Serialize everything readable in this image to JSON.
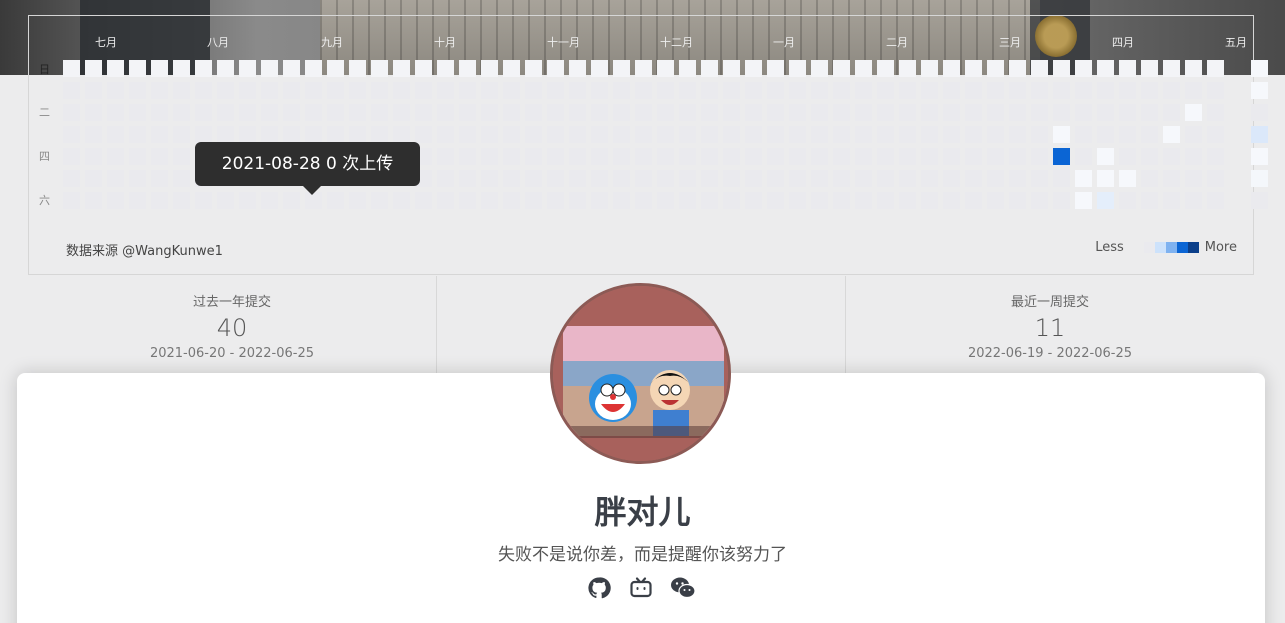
{
  "calendar": {
    "months": [
      "七月",
      "八月",
      "九月",
      "十月",
      "十一月",
      "十二月",
      "一月",
      "二月",
      "三月",
      "四月",
      "五月"
    ],
    "weekdays": [
      "日",
      "二",
      "四",
      "六"
    ],
    "tooltip": "2021-08-28 0 次上传",
    "source": "数据来源 @WangKunwe1",
    "legend_less": "Less",
    "legend_more": "More",
    "legend_colors": [
      "#eaeaee",
      "#cde2fb",
      "#7fb2f0",
      "#0b65d4",
      "#0b3f8a"
    ]
  },
  "stats": [
    {
      "label": "过去一年提交",
      "value": "40",
      "range": "2021-06-20 - 2022-06-25"
    },
    {
      "label": "最近一周提交",
      "value": "11",
      "range": "2022-06-19 - 2022-06-25"
    }
  ],
  "profile": {
    "name": "胖对儿",
    "motto": "失败不是说你差，而是提醒你该努力了",
    "social_icons": [
      "github-icon",
      "bilibili-icon",
      "wechat-icon"
    ]
  }
}
